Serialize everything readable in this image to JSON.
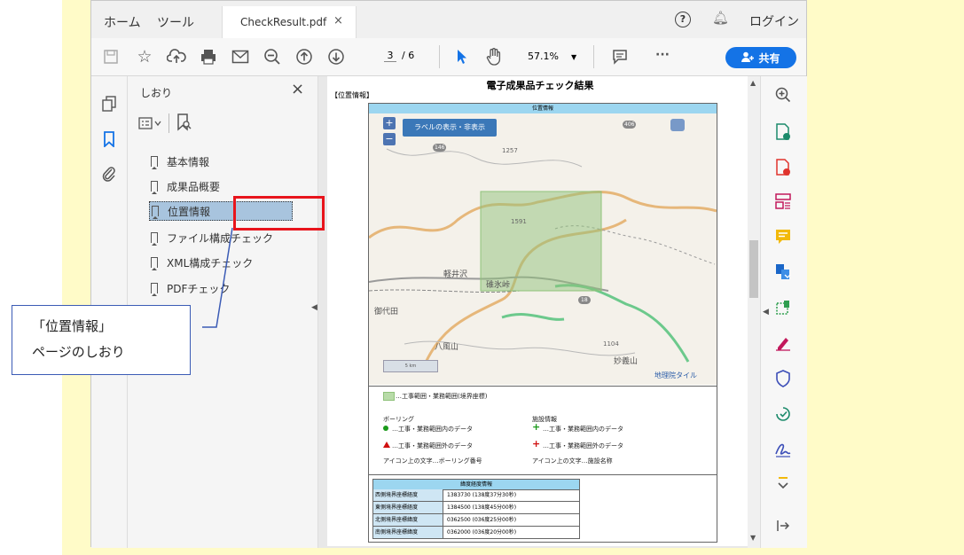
{
  "tabs": {
    "home": "ホーム",
    "tools": "ツール",
    "file": "CheckResult.pdf",
    "close": "×"
  },
  "header": {
    "login": "ログイン"
  },
  "toolbar": {
    "page_current": "3",
    "page_total": "/ 6",
    "zoom": "57.1%",
    "share": "共有",
    "more": "···"
  },
  "bookmarks": {
    "title": "しおり",
    "close": "×",
    "items": [
      "基本情報",
      "成果品概要",
      "位置情報",
      "ファイル構成チェック",
      "XML構成チェック",
      "PDFチェック"
    ]
  },
  "document": {
    "title": "電子成果品チェック結果",
    "section": "【位置情報】",
    "map_header": "位置情報",
    "map_button": "ラベルの表示・非表示",
    "zoom_in": "+",
    "zoom_out": "−",
    "map_labels": {
      "peak1": "1257",
      "peak2": "1591",
      "peak3": "1104",
      "karuizawa": "軽井沢",
      "usui": "碓氷峠",
      "miyota": "御代田",
      "yatsuyama": "八風山",
      "myogi": "妙義山",
      "road1": "146",
      "road2": "18",
      "road3": "406",
      "nihon": "地理院タイル",
      "scale": "5 km"
    },
    "legend": {
      "area": "…工事範囲・業務範囲(境界座標)",
      "boring_title": "ボーリング",
      "boring_in": "…工事・業務範囲内のデータ",
      "boring_out": "…工事・業務範囲外のデータ",
      "boring_note": "アイコン上の文字…ボーリング番号",
      "facility_title": "施設情報",
      "facility_in": "…工事・業務範囲内のデータ",
      "facility_out": "…工事・業務範囲外のデータ",
      "facility_note": "アイコン上の文字…施設名称"
    },
    "coord_table": {
      "header": "緯度経度情報",
      "rows": [
        [
          "西側境界座標経度",
          "1383730 (138度37分30秒)"
        ],
        [
          "東側境界座標経度",
          "1384500 (138度45分00秒)"
        ],
        [
          "北側境界座標緯度",
          "0362500 (036度25分00秒)"
        ],
        [
          "南側境界座標緯度",
          "0362000 (036度20分00秒)"
        ]
      ]
    }
  },
  "callout": {
    "line1": "「位置情報」",
    "line2": "ページのしおり"
  },
  "colors": {
    "accent": "#1473e6",
    "highlight": "#e8141c",
    "selected": "#a8c4de"
  }
}
